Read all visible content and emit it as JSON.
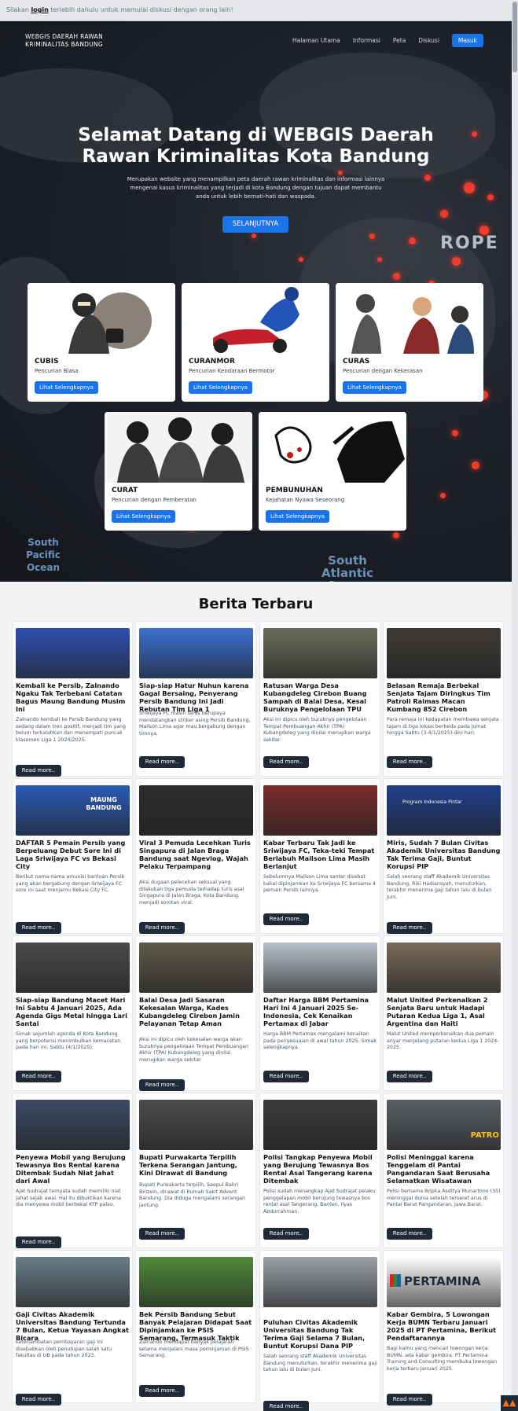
{
  "notice": {
    "prefix": "Silakan ",
    "link": "login",
    "suffix": " terlebih dahulu untuk memulai diskusi dengan orang lain!"
  },
  "nav": {
    "brand_line1": "WEBGIS DAERAH RAWAN",
    "brand_line2": "KRIMINALITAS BANDUNG",
    "links": [
      "Halaman Utama",
      "Informasi",
      "Peta",
      "Diskusi"
    ],
    "login": "Masuk"
  },
  "hero": {
    "title_line1": "Selamat Datang di WEBGIS Daerah",
    "title_line2": "Rawan Kriminalitas Kota Bandung",
    "subtitle": "Merupakan website yang menampilkan peta daerah rawan kriminalitas dan informasi lainnya mengenai kasus kriminalitas yang terjadi di kota Bandung dengan tujuan dapat membantu anda untuk lebih bernati-hati dan waspada.",
    "cta": "SELANJUTNYA",
    "map_labels": [
      "ROPE",
      "South Pacific Ocean",
      "South Atlantic Ocean"
    ]
  },
  "categories": [
    {
      "title": "CUBIS",
      "desc": "Pencurian Biasa",
      "button": "Lihat Selengkapnya"
    },
    {
      "title": "CURANMOR",
      "desc": "Pencurian Kendaraan Bermotor",
      "button": "Lihat Selengkapnya"
    },
    {
      "title": "CURAS",
      "desc": "Pencurian dengan Kekerasan",
      "button": "Lihat Selengkapnya"
    },
    {
      "title": "CURAT",
      "desc": "Pencurian dengan Pemberatan",
      "button": "Lihat Selengkapnya"
    },
    {
      "title": "PEMBUNUHAN",
      "desc": "Kejahatan Nyawa Seseorang",
      "button": "Lihat Selengkapnya"
    }
  ],
  "news": {
    "heading": "Berita Terbaru",
    "read_more": "Read more..",
    "items": [
      {
        "title": "Kembali ke Persib, Zalnando Ngaku Tak Terbebani Catatan Bagus Maung Bandung Musim Ini",
        "summary": "Zalnando kembali ke Persib Bandung yang sedang dalam tren positif, menjadi tim yang belum terkalahkan dan menempati puncak klasemen Liga 1 2024/2025."
      },
      {
        "title": "Siap-siap Hatur Nuhun karena Gagal Bersaing, Penyerang Persib Bandung Ini Jadi Rebutan Tim Liga 1",
        "summary": "Sriwijaya FC masih terus berupaya mendatangkan striker asing Persib Bandung, Mailson Lima agar mau bergabung dengan timnya."
      },
      {
        "title": "Ratusan Warga Desa Kubangdeleg Cirebon Buang Sampah di Balai Desa, Kesal Buruknya Pengelolaan TPU",
        "summary": "Aksi ini dipicu oleh buruknya pengelolaan Tempat Pembuangan Akhir (TPA) Kubangdeleg yang dinilai merugikan warga sekitar."
      },
      {
        "title": "Belasan Remaja Berbekal Senjata Tajam Diringkus Tim Patroli Raimas Macan Kumbang 852 Cirebon",
        "summary": "Para remaja ini kedapatan membawa senjata tajam di tiga lokasi berbeda pada Jumat hingga Sabtu (3-4/1/2025) dini hari."
      },
      {
        "title": "DAFTAR 5 Pemain Persib yang Berpeluang Debut Sore Ini di Laga Sriwijaya FC vs Bekasi City",
        "summary": "Berikut nama-nama amunisi bantuan Persib yang akan bergabung dengan Sriwijaya FC sore ini saat menjamu Bekasi City FC."
      },
      {
        "title": "Viral 3 Pemuda Lecehkan Turis Singapura di Jalan Braga Bandung saat Ngevlog, Wajah Pelaku Terpampang",
        "summary": "Aksi dugaan pelecehan seksual yang dilakukan tiga pemuda terhadap turis asal Singapura di Jalan Braga, Kota Bandung, menjadi sorotan viral."
      },
      {
        "title": "Kabar Terbaru Tak Jadi ke Sriwijaya FC, Teka-teki Tempat Berlabuh Mailson Lima Masih Berlanjut",
        "summary": "Sebelumnya Mailson Lima santer disebut bakal dipinjamkan ke Sriwijaya FC bersama 4 pemain Persib lainnya."
      },
      {
        "title": "Miris, Sudah 7 Bulan Civitas Akademik Universitas Bandung Tak Terima Gaji, Buntut Korupsi PIP",
        "summary": "Salah seorang staff Akademik Universitas Bandung, Riki Hadiansyah, menuturkan, terakhir menerima gaji tahun lalu di bulan Juni."
      },
      {
        "title": "Siap-siap Bandung Macet Hari Ini Sabtu 4 Januari 2025, Ada Agenda Gigs Metal hingga Lari Santai",
        "summary": "Simak sejumlah agenda di Kota Bandung yang berpotensi menimbulkan kemacetan pada hari ini, Sabtu (4/1/2025)."
      },
      {
        "title": "Balai Desa Jadi Sasaran Kekesalan Warga, Kades Kubangdeleg Cirebon Jamin Pelayanan Tetap Aman",
        "summary": "Aksi ini dipicu oleh kekesalan warga akan buruknya pengelolaan Tempat Pembuangan Akhir (TPA) Kubangdeleg yang dinilai merugikan warga sekitar."
      },
      {
        "title": "Daftar Harga BBM Pertamina Hari Ini 4 Januari 2025 Se-Indonesia, Cek Kenaikan Pertamax di Jabar",
        "summary": "Harga BBM Pertamax mengalami kenaikan pada penyesuaian di awal tahun 2025. Simak selengkapnya."
      },
      {
        "title": "Malut United Perkenalkan 2 Senjata Baru untuk Hadapi Putaran Kedua Liga 1, Asal Argentina dan Haiti",
        "summary": "Malut United memperkenalkan dua pemain anyar menjelang putaran kedua Liga 1 2024-2025."
      },
      {
        "title": "Penyewa Mobil yang Berujung Tewasnya Bos Rental karena Ditembak Sudah Niat Jahat dari Awal",
        "summary": "Ajat Sudrajat ternyata sudah memiliki niat jahat sejak awal. Hal itu dibuktikan karena dia menyewa mobil berbekal KTP palsu."
      },
      {
        "title": "Bupati Purwakarta Terpilih Terkena Serangan Jantung, Kini Dirawat di Bandung",
        "summary": "Bupati Purwakarta terpilih, Saepul Bahri Binzein, dirawat di Rumah Sakit Advent Bandung. Dia diduga mengalami serangan jantung."
      },
      {
        "title": "Polisi Tangkap Penyewa Mobil yang Berujung Tewasnya Bos Rental Asal Tangerang karena Ditembak",
        "summary": "Polisi sudah menangkap Ajat Sudrajat pelaku penggelapan mobil berujung tewasnya bos rental asal Tangerang, Banten, Ilyas Abdurrahman."
      },
      {
        "title": "Polisi Meninggal karena Tenggelam di Pantai Pangandaran Saat Berusaha Selamatkan Wisatawan",
        "summary": "Polisi bernama Bripka Asditya Munartono (35) meninggal dunia setelah terseret arus di Pantai Barat Pangandaran, Jawa Barat."
      },
      {
        "title": "Gaji Civitas Akademik Universitas Bandung Tertunda 7 Bulan, Ketua Yayasan Angkat Bicara",
        "summary": "keterlambatan pembayaran gaji ini disebabkan oleh penutupan salah satu fakultas di UB pada tahun 2023."
      },
      {
        "title": "Bek Persib Bandung Sebut Banyak Pelajaran Didapat Saat Dipinjamkan ke PSIS Semarang, Termasuk Taktik",
        "summary": "Zalnando mendapat banyak pelajaran selama menjalani masa peminjaman di PSIS Semarang."
      },
      {
        "title": "Puluhan Civitas Akademik Universitas Bandung Tak Terima Gaji Selama 7 Bulan, Buntut Korupsi Dana PIP",
        "summary": "Salah seorang staff Akademik Universitas Bandung menuturkan, terakhir menerima gaji tahun lalu di bulan Juni."
      },
      {
        "title": "Kabar Gembira, 5 Lowongan Kerja BUMN Terbaru Januari 2025 di PT Pertamina, Berikut Pendaftarannya",
        "summary": "Bagi kamu yang mencari lowongan kerja BUMN, ada kabar gembira. PT Pertamina Training and Consulting membuka lowongan kerja terbaru Januari 2025."
      }
    ]
  },
  "thumb_texts": {
    "maung": "MAUNG BANDUNG",
    "pertamina": "PERTAMINA",
    "patroli": "PATRO",
    "program": "Program Indonesia Pintar"
  },
  "colors": {
    "primary": "#1a73e8",
    "dark_button": "#1f2937",
    "hotspot": "#ef3b2c"
  }
}
